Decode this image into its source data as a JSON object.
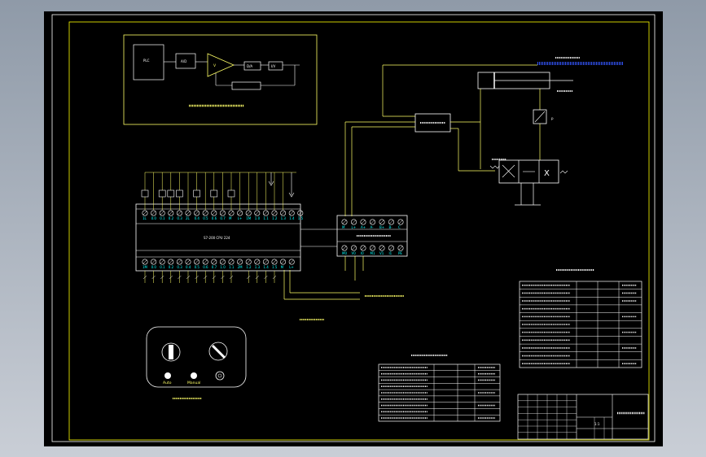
{
  "colors": {
    "background": "#000000",
    "frame": "#ffffff",
    "border": "#ffff00",
    "wire": "#ffff66",
    "device": "#ffffff",
    "dim_blue": "#3355ff",
    "viewport": "#8f9aa8"
  },
  "plc": {
    "model": "S7-200 CPU 224",
    "top_terminals": [
      "1L",
      "0.0",
      "0.1",
      "0.2",
      "0.3",
      "2L",
      "0.4",
      "0.5",
      "0.6",
      "0.7",
      "M",
      "L+",
      "1M",
      "1.0",
      "1.1",
      "1.2",
      "1.3",
      "1.4",
      "1.5"
    ],
    "bottom_terminals": [
      "1M",
      "0.0",
      "0.1",
      "0.2",
      "0.3",
      "0.4",
      "0.5",
      "0.6",
      "0.7",
      "1.0",
      "1.1",
      "2M",
      "1.2",
      "1.3",
      "1.4",
      "1.5",
      "M",
      "L+"
    ]
  },
  "module": {
    "top_terminals": [
      "M",
      "L+",
      "A+",
      "A-",
      "B+",
      "B-",
      "C"
    ],
    "bottom_terminals": [
      "M0",
      "V0",
      "I0",
      "M1",
      "V1",
      "I1",
      "PE"
    ]
  },
  "block_diagram": {
    "blocks": [
      "PLC",
      "A/D",
      "V",
      "D/A",
      "I/V"
    ]
  },
  "panel": {
    "buttons": [
      "Auto",
      "Manual"
    ]
  },
  "valve": {
    "symbol": "X"
  },
  "pointer_label": "p",
  "left_table": {
    "rows": 8
  },
  "right_table": {
    "rows": 10
  },
  "title_block": {
    "scale": "1:1"
  }
}
